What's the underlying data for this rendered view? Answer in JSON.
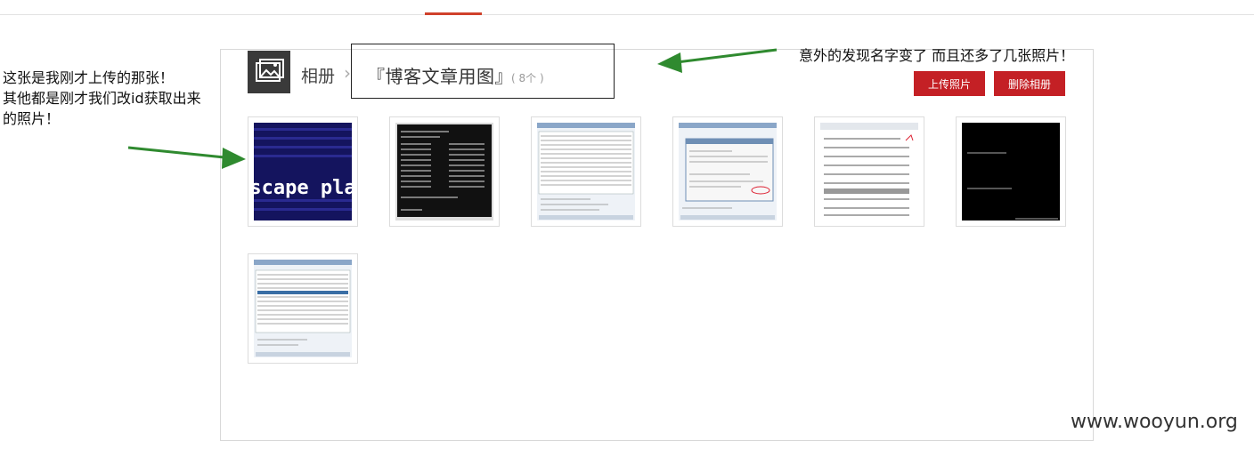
{
  "album": {
    "crumb_root": "相册",
    "title": "『博客文章用图』",
    "count": "( 8个 )",
    "upload_label": "上传照片",
    "delete_label": "删除相册"
  },
  "photos": [
    {
      "name": "escape-plan",
      "caption": "escape plan"
    },
    {
      "name": "terminal-output"
    },
    {
      "name": "app-table-window"
    },
    {
      "name": "dialog-window"
    },
    {
      "name": "list-screenshot"
    },
    {
      "name": "dark-terminal"
    },
    {
      "name": "app-table-window-2"
    }
  ],
  "annotations": {
    "left_note": [
      "这张是我刚才上传的那张！",
      "其他都是刚才我们改id获取出来",
      "的照片！"
    ],
    "right_note": "意外的发现名字变了    而且还多了几张照片！"
  },
  "watermark": "www.wooyun.org",
  "colors": {
    "accent": "#c42025",
    "arrow": "#2f8a2f",
    "tab_accent": "#d0412b"
  }
}
